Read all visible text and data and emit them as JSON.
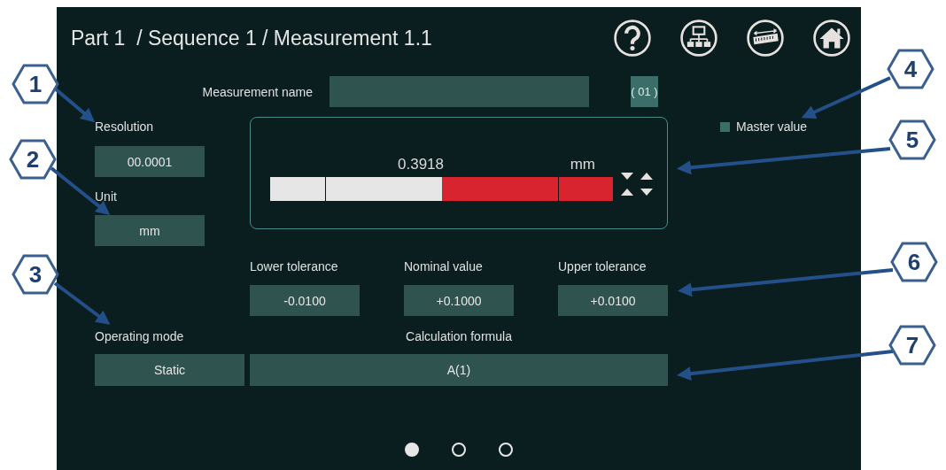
{
  "header": {
    "title": "Part 1  / Sequence 1 / Measurement 1.1"
  },
  "measurement_name": {
    "label": "Measurement name",
    "index_button": "( 01 )"
  },
  "resolution": {
    "label": "Resolution",
    "value": "00.0001"
  },
  "unit": {
    "label": "Unit",
    "value": "mm"
  },
  "master_value": {
    "label": "Master value",
    "checked": false
  },
  "gauge": {
    "reading": "0.3918",
    "unit": "mm",
    "level": 0.5
  },
  "tolerances": [
    {
      "label": "Lower tolerance",
      "value": "-0.0100"
    },
    {
      "label": "Nominal value",
      "value": "+0.1000"
    },
    {
      "label": "Upper tolerance",
      "value": "+0.0100"
    }
  ],
  "operating_mode": {
    "label": "Operating mode",
    "value": "Static"
  },
  "calculation_formula": {
    "label": "Calculation formula",
    "value": "A(1)"
  },
  "pages": [
    {
      "selected": true
    },
    {
      "selected": false
    },
    {
      "selected": false
    }
  ],
  "callouts": [
    {
      "label": "1"
    },
    {
      "label": "2"
    },
    {
      "label": "3"
    },
    {
      "label": "4"
    },
    {
      "label": "5"
    },
    {
      "label": "6"
    },
    {
      "label": "7"
    }
  ]
}
